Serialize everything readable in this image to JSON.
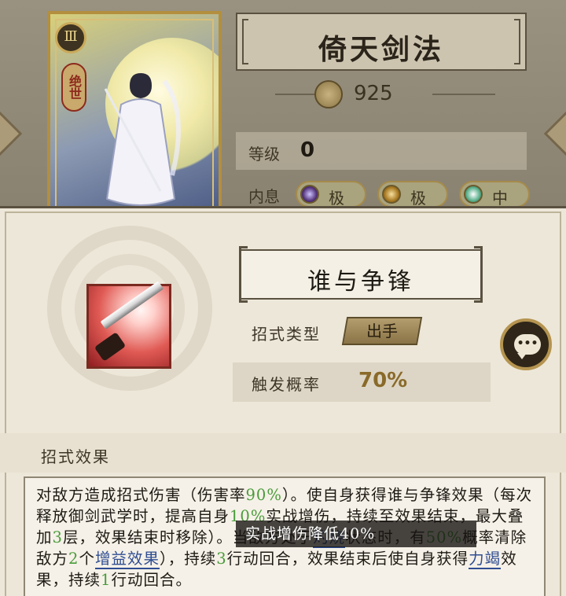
{
  "card": {
    "emblem": "Ⅲ",
    "tag": "绝世"
  },
  "martial_art": {
    "name": "倚天剑法",
    "power": "925",
    "level_label": "等级",
    "level_value": "0",
    "neixi_label": "内息",
    "neixi": [
      {
        "grade": "极"
      },
      {
        "grade": "极"
      },
      {
        "grade": "中"
      }
    ]
  },
  "skill": {
    "name": "谁与争锋",
    "type_label": "招式类型",
    "type_value": "出手",
    "rate_label": "触发概率",
    "rate_value": "70%"
  },
  "chat_button": {
    "dots": "•••"
  },
  "effect": {
    "title": "招式效果",
    "segments": [
      {
        "t": "对敌方造成招式伤害（伤害率",
        "c": ""
      },
      {
        "t": "90%",
        "c": "g"
      },
      {
        "t": "）。使自身获得谁与争锋效果（每次释放御剑武学时，提高自身",
        "c": ""
      },
      {
        "t": "10%",
        "c": "g"
      },
      {
        "t": "实战增伤，持续至效果结束，最大叠加",
        "c": ""
      },
      {
        "t": "3",
        "c": "g"
      },
      {
        "t": "层，",
        "c": ""
      },
      {
        "t": "效果结束时移除",
        "c": ""
      },
      {
        "t": "）。当敌方处于",
        "c": ""
      },
      {
        "t": "灼烧",
        "c": "u"
      },
      {
        "t": "状态时，有",
        "c": ""
      },
      {
        "t": "50%",
        "c": "g"
      },
      {
        "t": "概率清除敌方",
        "c": ""
      },
      {
        "t": "2",
        "c": "g"
      },
      {
        "t": "个",
        "c": ""
      },
      {
        "t": "增益效果",
        "c": "u"
      },
      {
        "t": "），持续",
        "c": ""
      },
      {
        "t": "3",
        "c": "g"
      },
      {
        "t": "行动回合，效果结束后使自身获得",
        "c": ""
      },
      {
        "t": "力竭",
        "c": "u"
      },
      {
        "t": "效果，持续",
        "c": ""
      },
      {
        "t": "1",
        "c": "g"
      },
      {
        "t": "行动回合。",
        "c": ""
      }
    ]
  },
  "tooltip": {
    "text": "实战增伤降低40%"
  },
  "colors": {
    "highlight_green": "#4a9b3a",
    "keyword_blue": "#2f4d92",
    "rate_gold": "#8a6a2a"
  }
}
